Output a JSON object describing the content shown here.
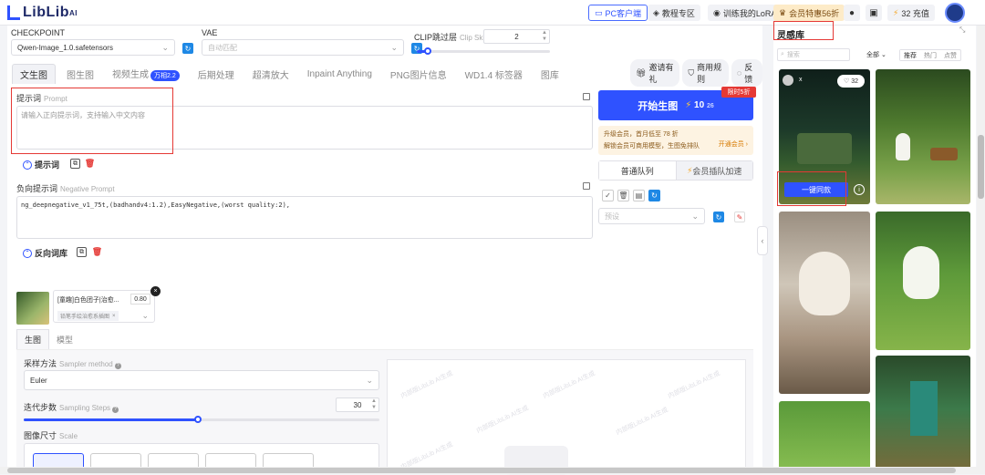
{
  "topbar": {
    "logo": "LibLib",
    "logo_sup": "AI",
    "pc_client": "PC客户端",
    "course": "教程专区",
    "train_lora": "训练我的LoRA",
    "vip": "会员特惠56折",
    "recharge": "32 充值"
  },
  "model": {
    "checkpoint_label": "CHECKPOINT",
    "checkpoint_value": "Qwen-Image_1.0.safetensors",
    "vae_label": "VAE",
    "vae_value": "自动匹配",
    "clip_label": "CLIP跳过层",
    "clip_label_en": "Clip Skip",
    "clip_value": "2",
    "clip_fraction": 0.08
  },
  "tabs": [
    {
      "label": "文生图",
      "active": true
    },
    {
      "label": "图生图"
    },
    {
      "label": "视频生成",
      "badge": "万相2.2"
    },
    {
      "label": "后期处理"
    },
    {
      "label": "超清放大"
    },
    {
      "label": "Inpaint Anything"
    },
    {
      "label": "PNG图片信息"
    },
    {
      "label": "WD1.4 标签器"
    },
    {
      "label": "图库"
    }
  ],
  "right_links": {
    "invite": "邀请有礼",
    "commercial": "商用规则",
    "feedback": "反馈"
  },
  "prompt": {
    "label": "提示词",
    "label_en": "Prompt",
    "placeholder": "请输入正向提示词，支持输入中文内容",
    "library": "提示词"
  },
  "negative": {
    "label": "负向提示词",
    "label_en": "Negative Prompt",
    "value": "ng_deepnegative_v1_75t,(badhandv4:1.2),EasyNegative,(worst quality:2),",
    "library": "反向词库"
  },
  "generate": {
    "label": "开始生图",
    "cost": "10",
    "cost_old": "26",
    "limit_badge": "限时5折",
    "vip_line1": "升级会员，首月低至 78 折",
    "vip_line2": "解锁会员可商用模型，生图免排队",
    "vip_cta": "开通会员 ›",
    "queue_normal": "普通队列",
    "queue_vip": "会员插队加速",
    "preset_placeholder": "预设"
  },
  "lora": {
    "name": "[童趣]白色团子|治愈...",
    "weight": "0.80",
    "tag": "铅笔手绘治愈系插图"
  },
  "subtabs": [
    {
      "label": "生图",
      "active": true
    },
    {
      "label": "模型"
    }
  ],
  "settings": {
    "sampler_label": "采样方法",
    "sampler_label_en": "Sampler method",
    "sampler_value": "Euler",
    "steps_label": "迭代步数",
    "steps_label_en": "Sampling Steps",
    "steps_value": "30",
    "steps_fraction": 0.49,
    "scale_label": "图像尺寸",
    "scale_label_en": "Scale"
  },
  "watermark": "内部版LibLib AI生成",
  "side": {
    "title": "灵感库",
    "search_placeholder": "搜索",
    "filter": "全部",
    "sort": [
      "推荐",
      "热门",
      "点赞"
    ],
    "like_count": "32",
    "like_user": "x",
    "same_button": "一键同款"
  },
  "colors": {
    "accent": "#2f52ff",
    "danger": "#e53935"
  }
}
